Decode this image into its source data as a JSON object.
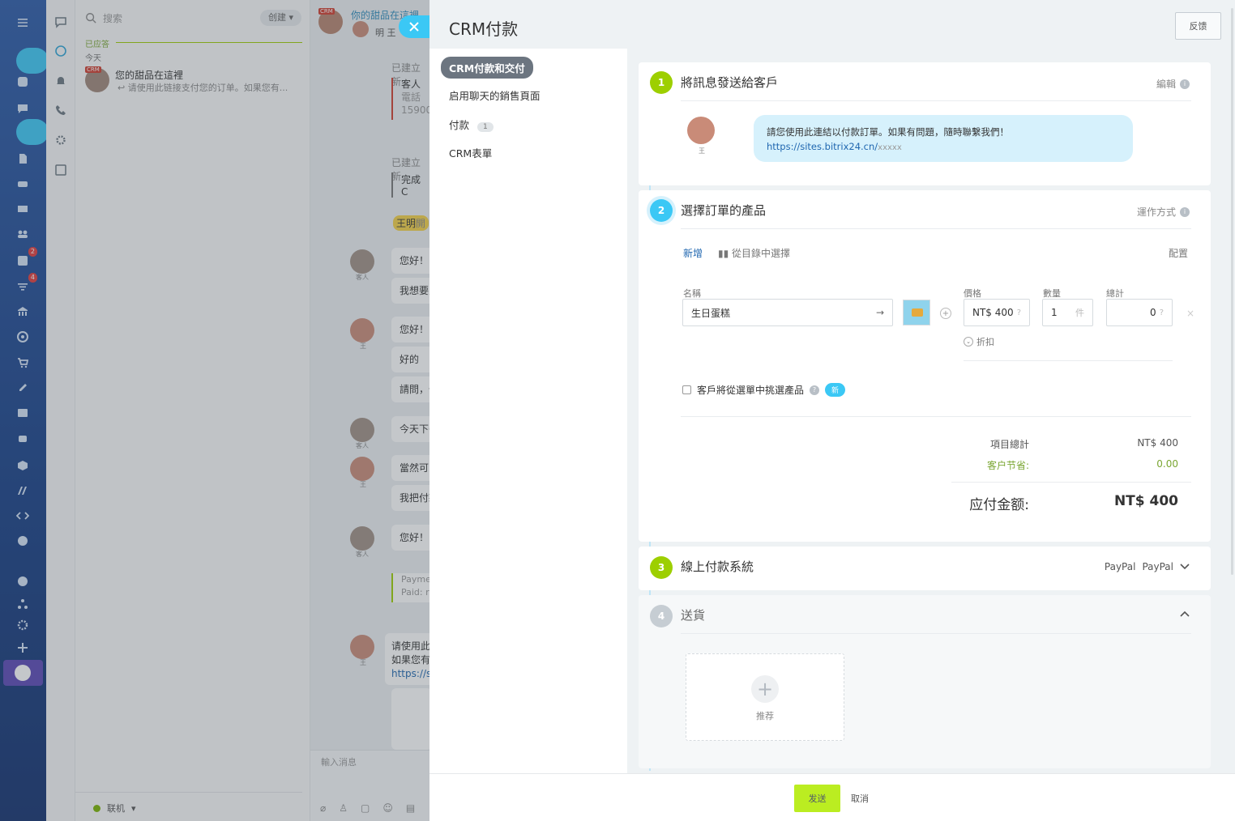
{
  "left_rail": {
    "badges": [
      "2",
      "4"
    ]
  },
  "chat_list": {
    "search_placeholder": "搜索",
    "create_label": "创建",
    "section_label": "已应答",
    "date_label": "今天",
    "item": {
      "crm_tag": "CRM",
      "title": "您的甜品在這裡",
      "preview": "请使用此链接支付您的订单。如果您有..."
    },
    "status_label": "联机"
  },
  "chat_window": {
    "header_title": "你的甜品在這裡",
    "header_user": "明 王",
    "crm_tag": "CRM",
    "lines": {
      "created1": "已建立新",
      "client_label": "客人",
      "phone_label": "電話",
      "phone_value": "15900",
      "created2": "已建立新",
      "done": "完成 C",
      "name_tag": "王明",
      "name_tag_suffix": "開"
    },
    "messages": [
      {
        "text": "您好！",
        "who": "客人"
      },
      {
        "text": "我想要買",
        "who": ""
      },
      {
        "text": "您好！",
        "who": "王"
      },
      {
        "text": "好的",
        "who": ""
      },
      {
        "text": "請問，什",
        "who": ""
      },
      {
        "text": "今天下午",
        "who": "客人"
      },
      {
        "text": "當然可以",
        "who": "王"
      },
      {
        "text": "我把付款",
        "who": ""
      },
      {
        "text": "您好！",
        "who": "客人"
      }
    ],
    "payment": {
      "line1": "Payme",
      "line2": "Paid: r"
    },
    "last_msg": {
      "line1": "请使用此",
      "line2": "如果您有",
      "line3": "https://s",
      "who": "王"
    },
    "input_placeholder": "輸入消息"
  },
  "slider": {
    "title": "CRM付款",
    "feedback_button": "反馈",
    "menu": [
      {
        "label": "CRM付款和交付",
        "active": true
      },
      {
        "label": "启用聊天的銷售頁面"
      },
      {
        "label": "付款",
        "count": "1"
      },
      {
        "label": "CRM表單"
      }
    ],
    "step1": {
      "num": "1",
      "title": "將訊息發送給客戶",
      "action": "編輯",
      "sender": "王",
      "message_text": "請您使用此連結以付款訂單。如果有問題，隨時聯繫我們！",
      "message_link": "https://sites.bitrix24.cn/",
      "message_link_suffix": "xxxxx"
    },
    "step2": {
      "num": "2",
      "title": "選擇訂單的產品",
      "action": "運作方式",
      "add_label": "新增",
      "catalog_label": "從目錄中選擇",
      "config_label": "配置",
      "name_label": "名稱",
      "product_name": "生日蛋糕",
      "price_label": "價格",
      "price_value": "NT$ 400",
      "qty_label": "數量",
      "qty_value": "1",
      "qty_unit": "件",
      "total_label": "總計",
      "total_value": "0",
      "discount_label": "折扣",
      "checkbox_label": "客戶將從選單中挑選產品",
      "new_badge": "新",
      "items_total_label": "項目總計",
      "items_total_value": "NT$ 400",
      "savings_label": "客户节省:",
      "savings_value": "0.00",
      "due_label": "应付金额:",
      "due_value": "NT$ 400"
    },
    "step3": {
      "num": "3",
      "title": "線上付款系統",
      "systems": [
        "PayPal",
        "PayPal"
      ]
    },
    "step4": {
      "num": "4",
      "title": "送貨",
      "tile_label": "推荐"
    },
    "send_button": "发送",
    "cancel_button": "取消"
  },
  "colors": {
    "accent_blue": "#3bc8f5",
    "green": "#9dcf00",
    "send_green": "#bbed21",
    "rail_blue": "#1f4b94"
  }
}
